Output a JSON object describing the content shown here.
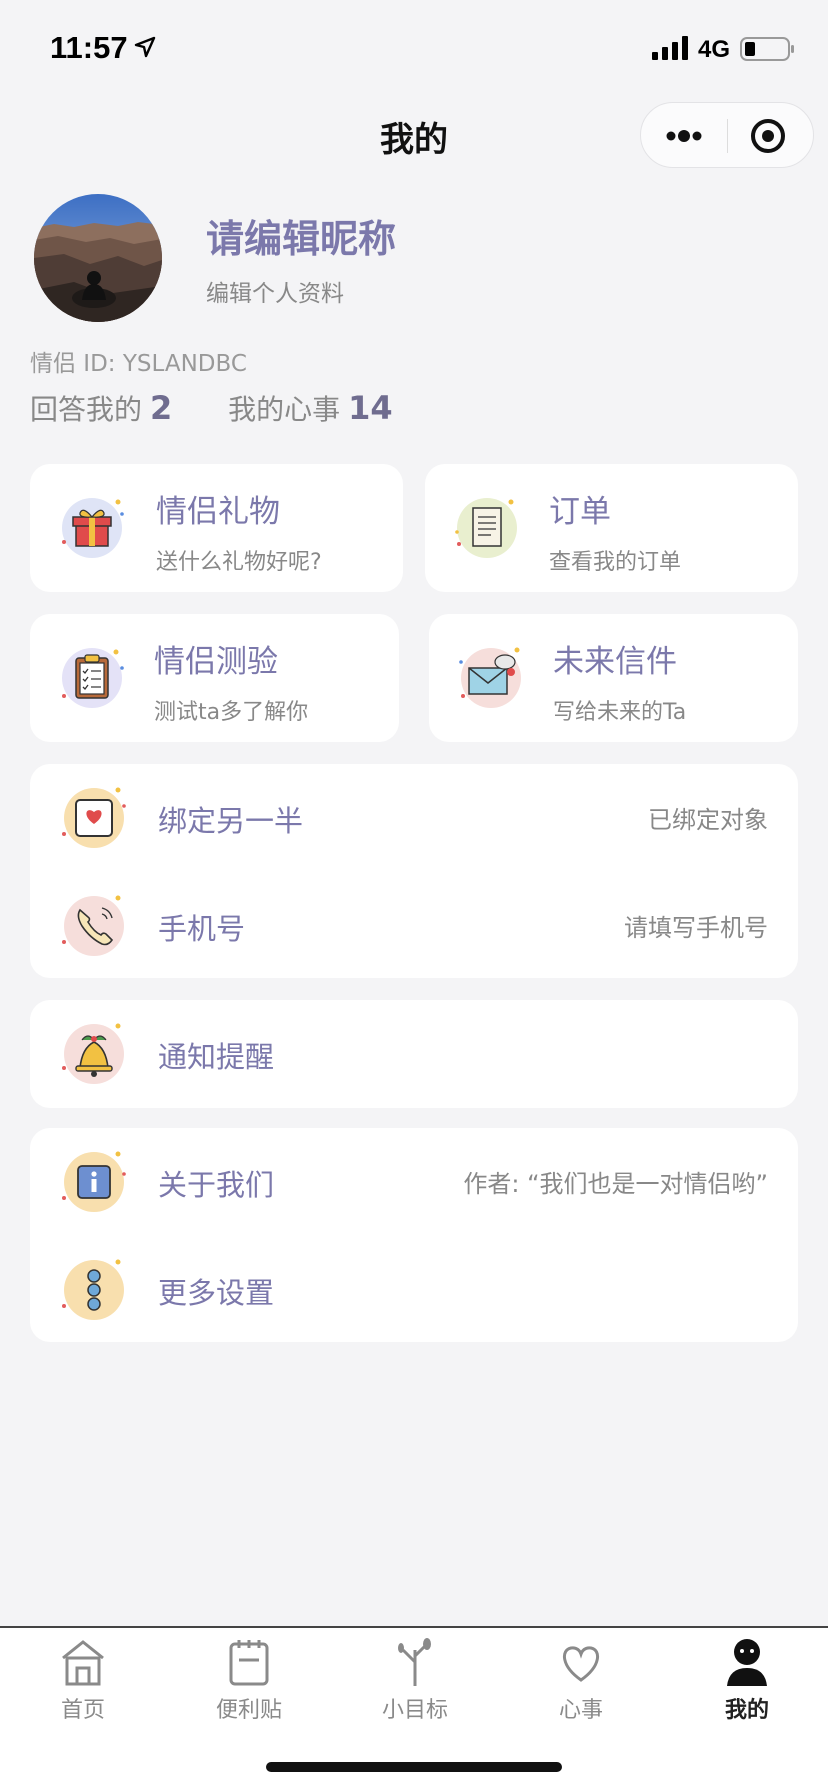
{
  "status_bar": {
    "time": "11:57",
    "network": "4G"
  },
  "header": {
    "title": "我的"
  },
  "profile": {
    "nickname": "请编辑昵称",
    "edit_link": "编辑个人资料",
    "couple_id": "情侣 ID: YSLANDBC",
    "answered_label": "回答我的",
    "answered_count": "2",
    "secrets_label": "我的心事",
    "secrets_count": "14"
  },
  "tiles": [
    {
      "title": "情侣礼物",
      "subtitle": "送什么礼物好呢?",
      "icon": "gift-icon"
    },
    {
      "title": "订单",
      "subtitle": "查看我的订单",
      "icon": "receipt-icon"
    },
    {
      "title": "情侣测验",
      "subtitle": "测试ta多了解你",
      "icon": "clipboard-icon"
    },
    {
      "title": "未来信件",
      "subtitle": "写给未来的Ta",
      "icon": "envelope-icon"
    }
  ],
  "list_group_1": [
    {
      "label": "绑定另一半",
      "value": "已绑定对象",
      "icon": "heart-frame-icon"
    },
    {
      "label": "手机号",
      "value": "请填写手机号",
      "icon": "phone-icon"
    }
  ],
  "list_group_2": [
    {
      "label": "通知提醒",
      "value": "",
      "icon": "bell-icon"
    }
  ],
  "list_group_3": [
    {
      "label": "关于我们",
      "value": "作者: “我们也是一对情侣哟”",
      "icon": "info-icon"
    },
    {
      "label": "更多设置",
      "value": "",
      "icon": "more-dots-icon"
    }
  ],
  "tabbar": [
    {
      "label": "首页",
      "icon": "home-icon"
    },
    {
      "label": "便利贴",
      "icon": "notepad-icon"
    },
    {
      "label": "小目标",
      "icon": "sprout-icon"
    },
    {
      "label": "心事",
      "icon": "heart-icon"
    },
    {
      "label": "我的",
      "icon": "user-icon",
      "active": true
    }
  ],
  "colors": {
    "accent": "#7b78ab",
    "background": "#f4f4f6"
  }
}
